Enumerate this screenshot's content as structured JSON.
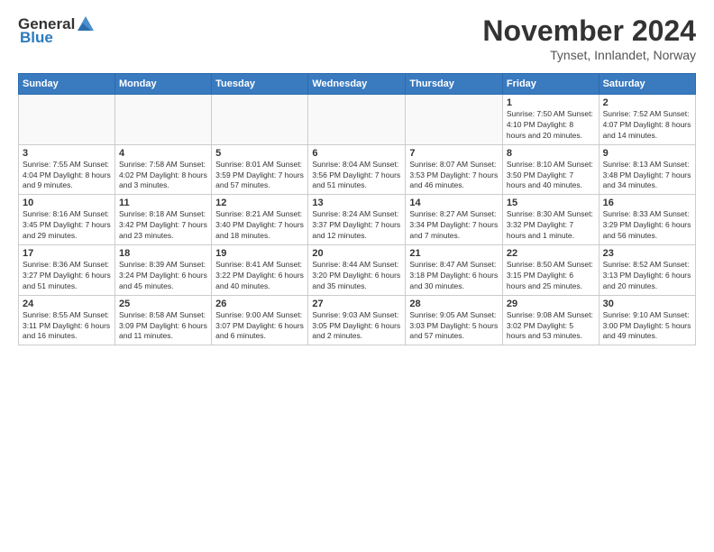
{
  "logo": {
    "general": "General",
    "blue": "Blue"
  },
  "header": {
    "month_year": "November 2024",
    "location": "Tynset, Innlandet, Norway"
  },
  "weekdays": [
    "Sunday",
    "Monday",
    "Tuesday",
    "Wednesday",
    "Thursday",
    "Friday",
    "Saturday"
  ],
  "weeks": [
    [
      {
        "day": "",
        "info": ""
      },
      {
        "day": "",
        "info": ""
      },
      {
        "day": "",
        "info": ""
      },
      {
        "day": "",
        "info": ""
      },
      {
        "day": "",
        "info": ""
      },
      {
        "day": "1",
        "info": "Sunrise: 7:50 AM\nSunset: 4:10 PM\nDaylight: 8 hours\nand 20 minutes."
      },
      {
        "day": "2",
        "info": "Sunrise: 7:52 AM\nSunset: 4:07 PM\nDaylight: 8 hours\nand 14 minutes."
      }
    ],
    [
      {
        "day": "3",
        "info": "Sunrise: 7:55 AM\nSunset: 4:04 PM\nDaylight: 8 hours\nand 9 minutes."
      },
      {
        "day": "4",
        "info": "Sunrise: 7:58 AM\nSunset: 4:02 PM\nDaylight: 8 hours\nand 3 minutes."
      },
      {
        "day": "5",
        "info": "Sunrise: 8:01 AM\nSunset: 3:59 PM\nDaylight: 7 hours\nand 57 minutes."
      },
      {
        "day": "6",
        "info": "Sunrise: 8:04 AM\nSunset: 3:56 PM\nDaylight: 7 hours\nand 51 minutes."
      },
      {
        "day": "7",
        "info": "Sunrise: 8:07 AM\nSunset: 3:53 PM\nDaylight: 7 hours\nand 46 minutes."
      },
      {
        "day": "8",
        "info": "Sunrise: 8:10 AM\nSunset: 3:50 PM\nDaylight: 7 hours\nand 40 minutes."
      },
      {
        "day": "9",
        "info": "Sunrise: 8:13 AM\nSunset: 3:48 PM\nDaylight: 7 hours\nand 34 minutes."
      }
    ],
    [
      {
        "day": "10",
        "info": "Sunrise: 8:16 AM\nSunset: 3:45 PM\nDaylight: 7 hours\nand 29 minutes."
      },
      {
        "day": "11",
        "info": "Sunrise: 8:18 AM\nSunset: 3:42 PM\nDaylight: 7 hours\nand 23 minutes."
      },
      {
        "day": "12",
        "info": "Sunrise: 8:21 AM\nSunset: 3:40 PM\nDaylight: 7 hours\nand 18 minutes."
      },
      {
        "day": "13",
        "info": "Sunrise: 8:24 AM\nSunset: 3:37 PM\nDaylight: 7 hours\nand 12 minutes."
      },
      {
        "day": "14",
        "info": "Sunrise: 8:27 AM\nSunset: 3:34 PM\nDaylight: 7 hours\nand 7 minutes."
      },
      {
        "day": "15",
        "info": "Sunrise: 8:30 AM\nSunset: 3:32 PM\nDaylight: 7 hours\nand 1 minute."
      },
      {
        "day": "16",
        "info": "Sunrise: 8:33 AM\nSunset: 3:29 PM\nDaylight: 6 hours\nand 56 minutes."
      }
    ],
    [
      {
        "day": "17",
        "info": "Sunrise: 8:36 AM\nSunset: 3:27 PM\nDaylight: 6 hours\nand 51 minutes."
      },
      {
        "day": "18",
        "info": "Sunrise: 8:39 AM\nSunset: 3:24 PM\nDaylight: 6 hours\nand 45 minutes."
      },
      {
        "day": "19",
        "info": "Sunrise: 8:41 AM\nSunset: 3:22 PM\nDaylight: 6 hours\nand 40 minutes."
      },
      {
        "day": "20",
        "info": "Sunrise: 8:44 AM\nSunset: 3:20 PM\nDaylight: 6 hours\nand 35 minutes."
      },
      {
        "day": "21",
        "info": "Sunrise: 8:47 AM\nSunset: 3:18 PM\nDaylight: 6 hours\nand 30 minutes."
      },
      {
        "day": "22",
        "info": "Sunrise: 8:50 AM\nSunset: 3:15 PM\nDaylight: 6 hours\nand 25 minutes."
      },
      {
        "day": "23",
        "info": "Sunrise: 8:52 AM\nSunset: 3:13 PM\nDaylight: 6 hours\nand 20 minutes."
      }
    ],
    [
      {
        "day": "24",
        "info": "Sunrise: 8:55 AM\nSunset: 3:11 PM\nDaylight: 6 hours\nand 16 minutes."
      },
      {
        "day": "25",
        "info": "Sunrise: 8:58 AM\nSunset: 3:09 PM\nDaylight: 6 hours\nand 11 minutes."
      },
      {
        "day": "26",
        "info": "Sunrise: 9:00 AM\nSunset: 3:07 PM\nDaylight: 6 hours\nand 6 minutes."
      },
      {
        "day": "27",
        "info": "Sunrise: 9:03 AM\nSunset: 3:05 PM\nDaylight: 6 hours\nand 2 minutes."
      },
      {
        "day": "28",
        "info": "Sunrise: 9:05 AM\nSunset: 3:03 PM\nDaylight: 5 hours\nand 57 minutes."
      },
      {
        "day": "29",
        "info": "Sunrise: 9:08 AM\nSunset: 3:02 PM\nDaylight: 5 hours\nand 53 minutes."
      },
      {
        "day": "30",
        "info": "Sunrise: 9:10 AM\nSunset: 3:00 PM\nDaylight: 5 hours\nand 49 minutes."
      }
    ]
  ]
}
